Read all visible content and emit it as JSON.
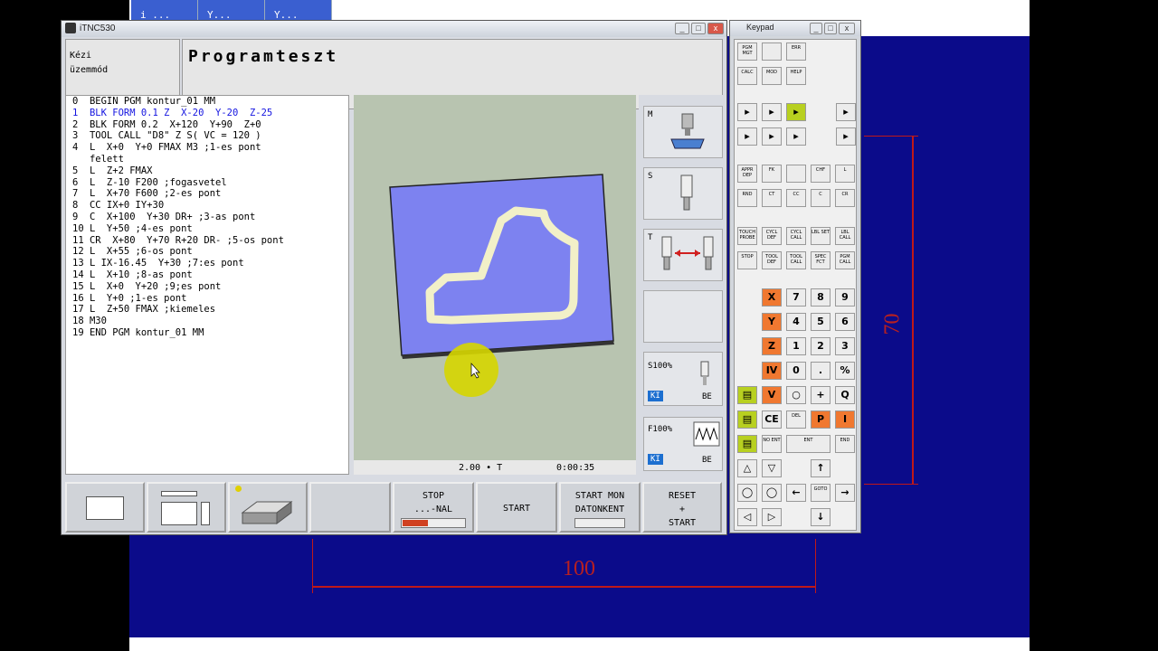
{
  "background": {
    "tabs": [
      "i ...",
      "Y...",
      "Y..."
    ],
    "dim_vertical": "70",
    "dim_horizontal": "100"
  },
  "tnc_window": {
    "title": "iTNC530",
    "controls": [
      "_",
      "□",
      "x"
    ],
    "mode_line1": "Kézi",
    "mode_line2": "üzemmód",
    "program_title": "Programteszt",
    "code_lines": [
      "0  BEGIN PGM kontur_01 MM",
      "1  BLK FORM 0.1 Z  X-20  Y-20  Z-25",
      "2  BLK FORM 0.2  X+120  Y+90  Z+0",
      "3  TOOL CALL \"D8\" Z S( VC = 120 )",
      "4  L  X+0  Y+0 FMAX M3 ;1-es pont",
      "   felett",
      "5  L  Z+2 FMAX",
      "6  L  Z-10 F200 ;fogasvetel",
      "7  L  X+70 F600 ;2-es pont",
      "8  CC IX+0 IY+30",
      "9  C  X+100  Y+30 DR+ ;3-as pont",
      "10 L  Y+50 ;4-es pont",
      "11 CR  X+80  Y+70 R+20 DR- ;5-os pont",
      "12 L  X+55 ;6-os pont",
      "13 L IX-16.45  Y+30 ;7:es pont",
      "14 L  X+10 ;8-as pont",
      "15 L  X+0  Y+20 ;9;es pont",
      "16 L  Y+0 ;1-es pont",
      "17 L  Z+50 FMAX ;kiemeles",
      "18 M30",
      "19 END PGM kontur_01 MM"
    ],
    "highlight_line": 1,
    "status_scale": "2.00 • T",
    "status_time": "0:00:35",
    "right_panel": {
      "m_label": "M",
      "s_label": "S",
      "t_label": "T",
      "spindle_override": "S100%",
      "feed_override": "F100%",
      "ki": "KI",
      "be": "BE"
    },
    "softkeys": {
      "stop_line1": "STOP",
      "stop_line2": "...-NAL",
      "start": "START",
      "start_mon_line1": "START MON",
      "start_mon_line2": "DATONKENT",
      "reset_line1": "RESET",
      "reset_line2": "+",
      "reset_line3": "START"
    }
  },
  "keypad_window": {
    "title": "Keypad",
    "top_keys": [
      "PGM MGT",
      "",
      "ERR",
      "CALC",
      "MOD",
      "HELP"
    ],
    "prog_keys": [
      "APPR DEP",
      "FK",
      "",
      "CHF",
      "L",
      "RND",
      "CT",
      "CC",
      "C",
      "CR"
    ],
    "cycle_keys": [
      "TOUCH PROBE",
      "CYCL DEF",
      "CYCL CALL",
      "LBL SET",
      "LBL CALL",
      "STOP",
      "TOOL DEF",
      "TOOL CALL",
      "SPEC FCT",
      "PGM CALL"
    ],
    "axis_keys": [
      "X",
      "Y",
      "Z",
      "IV",
      "V"
    ],
    "digits": [
      "7",
      "8",
      "9",
      "4",
      "5",
      "6",
      "1",
      "2",
      "3",
      "0",
      ".",
      "%"
    ],
    "plus": "+",
    "q": "Q",
    "p": "P",
    "i": "I",
    "ent": "ENT",
    "end": "END",
    "no_ent": "NO ENT",
    "del": "DEL",
    "goto": "GOTO"
  },
  "colors": {
    "blue_bg": "#0b0b8a",
    "blank_face": "#7d82f0",
    "toolpath": "#f2f0c8",
    "cursor_highlight": "#d6d600"
  }
}
